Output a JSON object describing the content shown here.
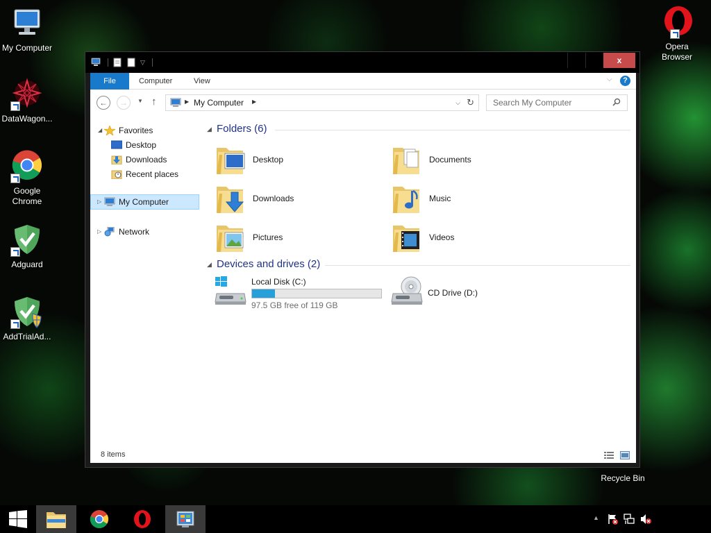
{
  "desktop": {
    "icons": [
      {
        "label": "My Computer"
      },
      {
        "label": "DataWagon..."
      },
      {
        "label": "Google Chrome"
      },
      {
        "label": "Adguard"
      },
      {
        "label": "AddTrialAd..."
      },
      {
        "label": "Opera Browser"
      },
      {
        "label": "Recycle Bin"
      }
    ]
  },
  "window": {
    "close_label": "x",
    "tabs": [
      {
        "label": "File"
      },
      {
        "label": "Computer"
      },
      {
        "label": "View"
      }
    ],
    "help_label": "?",
    "address": {
      "crumb": "My Computer"
    },
    "search": {
      "placeholder": "Search My Computer"
    },
    "navpane": {
      "favorites": "Favorites",
      "desktop": "Desktop",
      "downloads": "Downloads",
      "recent": "Recent places",
      "mycomputer": "My Computer",
      "network": "Network"
    },
    "folders_header": "Folders (6)",
    "folders": [
      {
        "label": "Desktop"
      },
      {
        "label": "Documents"
      },
      {
        "label": "Downloads"
      },
      {
        "label": "Music"
      },
      {
        "label": "Pictures"
      },
      {
        "label": "Videos"
      }
    ],
    "drives_header": "Devices and drives (2)",
    "drives": [
      {
        "label": "Local Disk (C:)",
        "free": "97.5 GB free of 119 GB",
        "used_fraction": 0.18
      },
      {
        "label": "CD Drive (D:)"
      }
    ],
    "status": {
      "item_count": "8 items"
    }
  },
  "colors": {
    "accent": "#1979ca",
    "drive_bar": "#26a0da",
    "header_text": "#1e3287",
    "selected_bg": "#cce8ff",
    "close_button": "#c74b4b"
  },
  "taskbar": {
    "buttons": [
      "windows-start-icon",
      "file-explorer-icon",
      "chrome-icon",
      "opera-icon",
      "control-panel-icon"
    ],
    "tray": [
      "action-center-flag-icon",
      "network-icon",
      "volume-muted-icon"
    ]
  }
}
